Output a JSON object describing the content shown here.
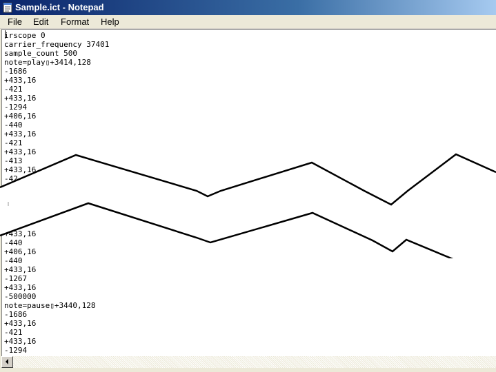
{
  "window": {
    "title": "Sample.ict - Notepad"
  },
  "menu": {
    "file": "File",
    "edit": "Edit",
    "format": "Format",
    "help": "Help"
  },
  "icons": {
    "app": "notepad-icon",
    "scroll_left": "arrow-left-icon"
  },
  "document": {
    "upper_text": "irscope 0\ncarrier_frequency 37401\nsample_count 500\nnote=play▯+3414,128\n-1686\n+433,16\n-421\n+433,16\n-1294\n+406,16\n-440\n+433,16\n-421\n+433,16\n-413\n+433,16\n-42",
    "lower_text": "+433,16\n-440\n+406,16\n-440\n+433,16\n-1267\n+433,16\n-500000\nnote=pause▯+3440,128\n-1686\n+433,16\n-421\n+433,16\n-1294"
  }
}
